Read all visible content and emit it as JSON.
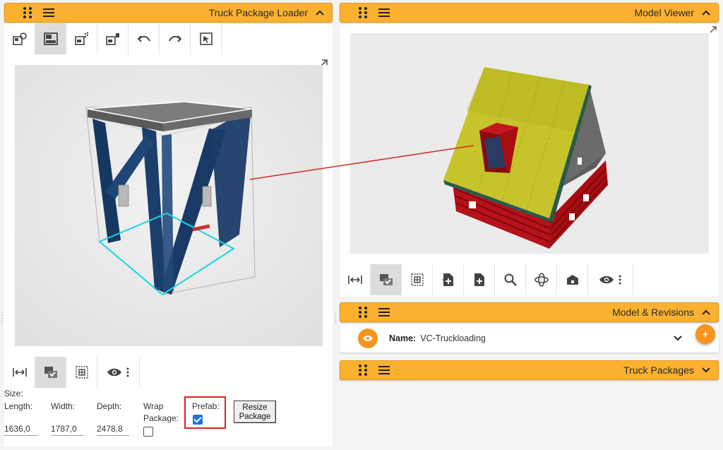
{
  "left_panel": {
    "title": "Truck Package Loader",
    "toolbar": [
      "add-object-icon",
      "layout-icon",
      "scatter-icon",
      "package-icon",
      "undo-icon",
      "redo-icon",
      "cursor-select-icon"
    ],
    "bottom_toolbar": [
      "measure-icon",
      "check-select-icon",
      "grid-select-icon",
      "eye-icon"
    ],
    "size_label": "Size:",
    "fields": {
      "length_label": "Length:",
      "length_value": "1636,0",
      "width_label": "Width:",
      "width_value": "1787,0",
      "depth_label": "Depth:",
      "depth_value": "2478,8",
      "wrap_label_1": "Wrap",
      "wrap_label_2": "Package:",
      "wrap_checked": false,
      "prefab_label": "Prefab:",
      "prefab_checked": true
    },
    "resize_button": {
      "line1": "Resize",
      "line2": "Package"
    }
  },
  "right_panel": {
    "title": "Model Viewer",
    "toolbar": [
      "measure-icon",
      "check-select-icon",
      "grid-select-icon",
      "add-file-icon",
      "file-plus-icon",
      "search-icon",
      "orbit-icon",
      "home-icon",
      "eye-icon"
    ]
  },
  "revisions_panel": {
    "title": "Model & Revisions",
    "name_label": "Name:",
    "name_value": "VC-Truckloading",
    "fab_label": "+"
  },
  "truck_packages_panel": {
    "title": "Truck Packages"
  },
  "colors": {
    "header": "#fbb12f",
    "accent": "#f7941d",
    "checkbox": "#1a73e8",
    "highlight": "#e02020"
  }
}
